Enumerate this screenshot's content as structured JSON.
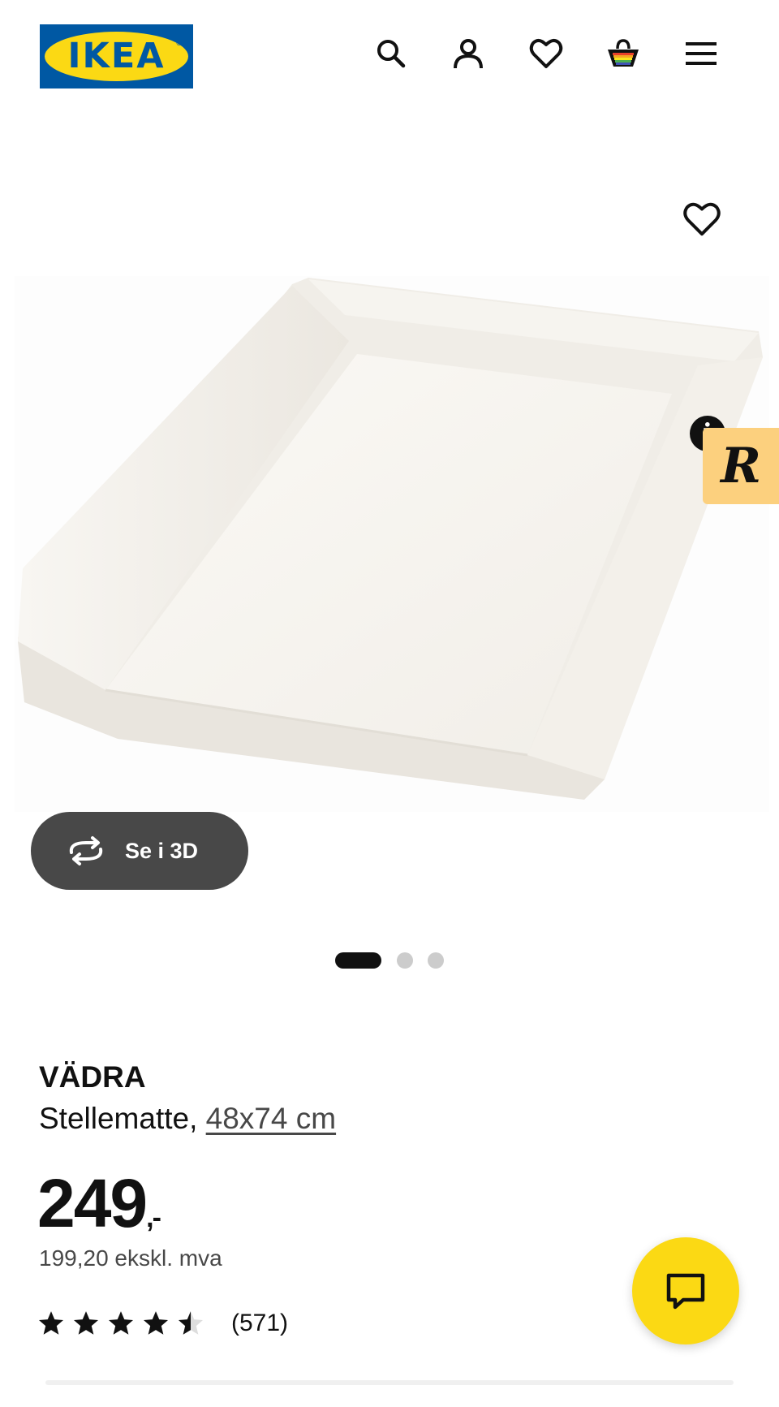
{
  "header": {
    "logo_text": "IKEA",
    "logo_reg": "®",
    "icons": [
      "search-icon",
      "account-icon",
      "wishlist-heart-icon",
      "shopping-basket-icon",
      "hamburger-menu-icon"
    ]
  },
  "gallery": {
    "favorite_icon": "heart-outline-icon",
    "info_badge": "i",
    "side_tab_letter": "R",
    "view_3d_label": "Se i 3D",
    "pages_total": 3,
    "page_active": 1
  },
  "product": {
    "name": "VÄDRA",
    "description": "Stellematte, ",
    "size_link": "48x74 cm",
    "price": "249",
    "price_suffix": ",-",
    "price_ex_vat": "199,20 ekskl. mva",
    "rating": 4.5,
    "rating_max": 5,
    "review_count": "(571)"
  },
  "colors": {
    "ikea_blue": "#0058a3",
    "ikea_yellow": "#fbd914",
    "button_dark": "#484848",
    "side_tab": "#fcd07e"
  }
}
